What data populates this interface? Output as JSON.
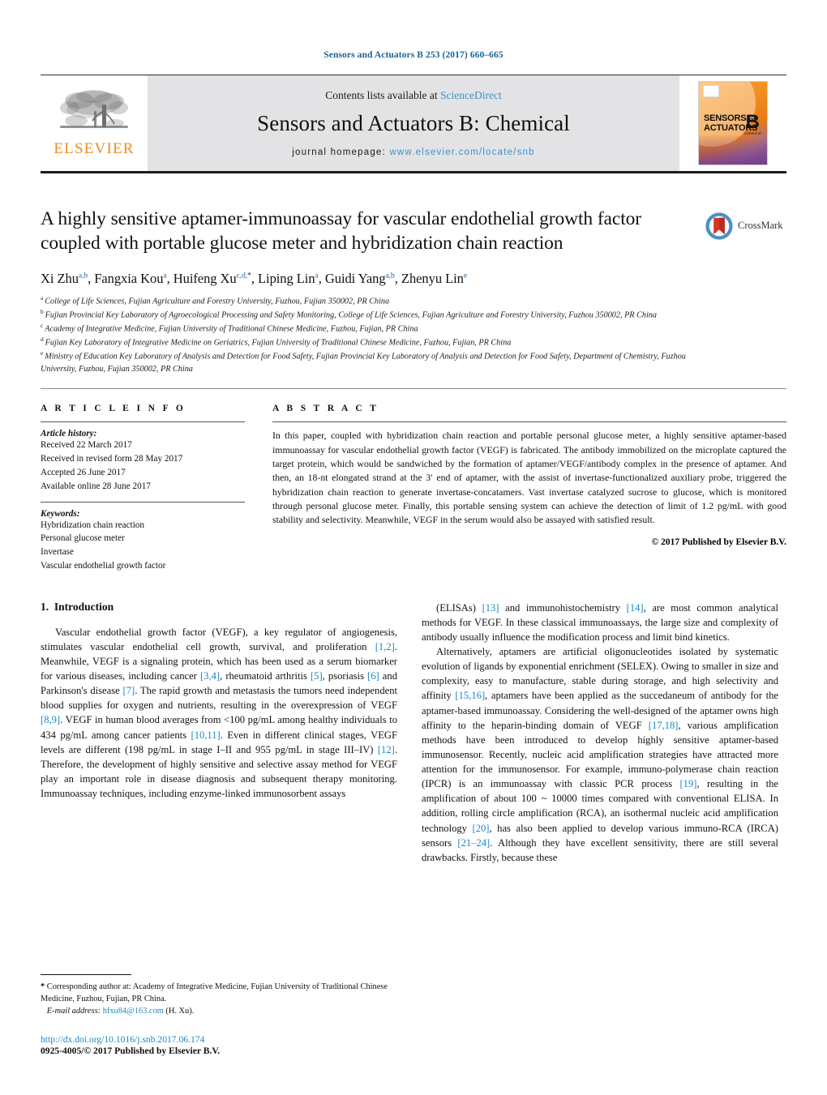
{
  "running_head": "Sensors and Actuators B 253 (2017) 660–665",
  "masthead": {
    "contents_prefix": "Contents lists available at ",
    "contents_link": "ScienceDirect",
    "journal_title": "Sensors and Actuators B: Chemical",
    "homepage_prefix": "journal homepage: ",
    "homepage_url": "www.elsevier.com/locate/snb",
    "publisher_logo_text": "ELSEVIER",
    "cover": {
      "line1": "SENSORS",
      "line1_suffix": "and",
      "line2": "ACTUATORS",
      "volume_letter": "B",
      "volume_sub": "Chemical"
    }
  },
  "article": {
    "title": "A highly sensitive aptamer-immunoassay for vascular endothelial growth factor coupled with portable glucose meter and hybridization chain reaction",
    "crossmark_label": "CrossMark",
    "authors": [
      {
        "name": "Xi Zhu",
        "sup": "a,b",
        "sep": ", "
      },
      {
        "name": "Fangxia Kou",
        "sup": "a",
        "sep": ", "
      },
      {
        "name": "Huifeng Xu",
        "sup": "c,d,",
        "star": "*",
        "sep": ", "
      },
      {
        "name": "Liping Lin",
        "sup": "a",
        "sep": ", "
      },
      {
        "name": "Guidi Yang",
        "sup": "a,b",
        "sep": ", "
      },
      {
        "name": "Zhenyu Lin",
        "sup": "e",
        "sep": ""
      }
    ],
    "affiliations": [
      {
        "mark": "a",
        "text": "College of Life Sciences, Fujian Agriculture and Forestry University, Fuzhou, Fujian 350002, PR China"
      },
      {
        "mark": "b",
        "text": "Fujian Provincial Key Laboratory of Agroecological Processing and Safety Monitoring, College of Life Sciences, Fujian Agriculture and Forestry University, Fuzhou 350002, PR China"
      },
      {
        "mark": "c",
        "text": "Academy of Integrative Medicine, Fujian University of Traditional Chinese Medicine, Fuzhou, Fujian, PR China"
      },
      {
        "mark": "d",
        "text": "Fujian Key Laboratory of Integrative Medicine on Geriatrics, Fujian University of Traditional Chinese Medicine, Fuzhou, Fujian, PR China"
      },
      {
        "mark": "e",
        "text": "Ministry of Education Key Laboratory of Analysis and Detection for Food Safety, Fujian Provincial Key Laboratory of Analysis and Detection for Food Safety, Department of Chemistry, Fuzhou University, Fuzhou, Fujian 350002, PR China"
      }
    ]
  },
  "article_info": {
    "heading": "A R T I C L E    I N F O",
    "history_label": "Article history:",
    "history": [
      "Received 22 March 2017",
      "Received in revised form 28 May 2017",
      "Accepted 26 June 2017",
      "Available online 28 June 2017"
    ],
    "keywords_label": "Keywords:",
    "keywords": [
      "Hybridization chain reaction",
      "Personal glucose meter",
      "Invertase",
      "Vascular endothelial growth factor"
    ]
  },
  "abstract": {
    "heading": "A B S T R A C T",
    "text": "In this paper, coupled with hybridization chain reaction and portable personal glucose meter, a highly sensitive aptamer-based immunoassay for vascular endothelial growth factor (VEGF) is fabricated. The antibody immobilized on the microplate captured the target protein, which would be sandwiched by the formation of aptamer/VEGF/antibody complex in the presence of aptamer. And then, an 18-nt elongated strand at the 3′ end of aptamer, with the assist of invertase-functionalized auxiliary probe, triggered the hybridization chain reaction to generate invertase-concatamers. Vast invertase catalyzed sucrose to glucose, which is monitored through personal glucose meter. Finally, this portable sensing system can achieve the detection of limit of 1.2 pg/mL with good stability and selectivity. Meanwhile, VEGF in the serum would also be assayed with satisfied result.",
    "copyright": "© 2017 Published by Elsevier B.V."
  },
  "introduction": {
    "section_number": "1.",
    "section_title": "Introduction",
    "left_paragraphs": [
      "Vascular endothelial growth factor (VEGF), a key regulator of angiogenesis, stimulates vascular endothelial cell growth, survival, and proliferation [1,2]. Meanwhile, VEGF is a signaling protein, which has been used as a serum biomarker for various diseases, including cancer [3,4], rheumatoid arthritis [5], psoriasis [6] and Parkinson's disease [7]. The rapid growth and metastasis the tumors need independent blood supplies for oxygen and nutrients, resulting in the overexpression of VEGF [8,9]. VEGF in human blood averages from <100 pg/mL among healthy individuals to 434 pg/mL among cancer patients [10,11]. Even in different clinical stages, VEGF levels are different (198 pg/mL in stage I–II and 955 pg/mL in stage III–IV) [12]. Therefore, the development of highly sensitive and selective assay method for VEGF play an important role in disease diagnosis and subsequent therapy monitoring. Immunoassay techniques, including enzyme-linked immunosorbent assays"
    ],
    "right_paragraphs": [
      "(ELISAs) [13] and immunohistochemistry [14], are most common analytical methods for VEGF. In these classical immunoassays, the large size and complexity of antibody usually influence the modification process and limit bind kinetics.",
      "Alternatively, aptamers are artificial oligonucleotides isolated by systematic evolution of ligands by exponential enrichment (SELEX). Owing to smaller in size and complexity, easy to manufacture, stable during storage, and high selectivity and affinity [15,16], aptamers have been applied as the succedaneum of antibody for the aptamer-based immunoassay. Considering the well-designed of the aptamer owns high affinity to the heparin-binding domain of VEGF [17,18], various amplification methods have been introduced to develop highly sensitive aptamer-based immunosensor. Recently, nucleic acid amplification strategies have attracted more attention for the immunosensor. For example, immuno-polymerase chain reaction (IPCR) is an immunoassay with classic PCR process [19], resulting in the amplification of about 100 ~ 10000 times compared with conventional ELISA. In addition, rolling circle amplification (RCA), an isothermal nucleic acid amplification technology [20], has also been applied to develop various immuno-RCA (IRCA) sensors [21–24]. Although they have excellent sensitivity, there are still several drawbacks. Firstly, because these"
    ]
  },
  "footnote": {
    "star": "*",
    "corresponding": " Corresponding author at: Academy of Integrative Medicine, Fujian University of Traditional Chinese Medicine, Fuzhou, Fujian, PR China.",
    "email_label": "E-mail address:",
    "email": "hfxu84@163.com",
    "email_owner": "(H. Xu)."
  },
  "colophon": {
    "doi": "http://dx.doi.org/10.1016/j.snb.2017.06.174",
    "issn_line": "0925-4005/© 2017 Published by Elsevier B.V."
  },
  "colors": {
    "link": "#1a8ac0",
    "running_head": "#1a6496",
    "elsevier_orange": "#f08c1e",
    "masthead_bg": "#e3e3e5"
  }
}
